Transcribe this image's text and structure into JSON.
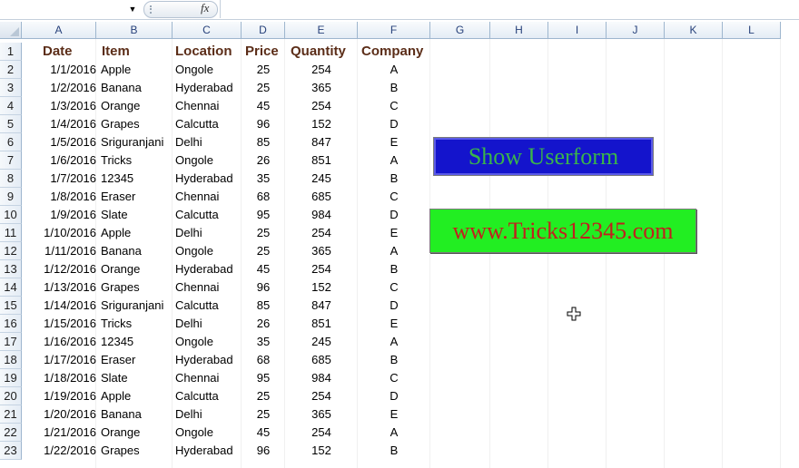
{
  "formula_bar": {
    "fx_label": "fx",
    "name_box_value": "",
    "formula_value": ""
  },
  "columns": [
    "A",
    "B",
    "C",
    "D",
    "E",
    "F",
    "G",
    "H",
    "I",
    "J",
    "K",
    "L"
  ],
  "rows": [
    "1",
    "2",
    "3",
    "4",
    "5",
    "6",
    "7",
    "8",
    "9",
    "10",
    "11",
    "12",
    "13",
    "14",
    "15",
    "16",
    "17",
    "18",
    "19",
    "20",
    "21",
    "22",
    "23"
  ],
  "table": {
    "headers": [
      "Date",
      "Item",
      "Location",
      "Price",
      "Quantity",
      "Company"
    ],
    "data": [
      [
        "1/1/2016",
        "Apple",
        "Ongole",
        "25",
        "254",
        "A"
      ],
      [
        "1/2/2016",
        "Banana",
        "Hyderabad",
        "25",
        "365",
        "B"
      ],
      [
        "1/3/2016",
        "Orange",
        "Chennai",
        "45",
        "254",
        "C"
      ],
      [
        "1/4/2016",
        "Grapes",
        "Calcutta",
        "96",
        "152",
        "D"
      ],
      [
        "1/5/2016",
        "Sriguranjani",
        "Delhi",
        "85",
        "847",
        "E"
      ],
      [
        "1/6/2016",
        "Tricks",
        "Ongole",
        "26",
        "851",
        "A"
      ],
      [
        "1/7/2016",
        "12345",
        "Hyderabad",
        "35",
        "245",
        "B"
      ],
      [
        "1/8/2016",
        "Eraser",
        "Chennai",
        "68",
        "685",
        "C"
      ],
      [
        "1/9/2016",
        "Slate",
        "Calcutta",
        "95",
        "984",
        "D"
      ],
      [
        "1/10/2016",
        "Apple",
        "Delhi",
        "25",
        "254",
        "E"
      ],
      [
        "1/11/2016",
        "Banana",
        "Ongole",
        "25",
        "365",
        "A"
      ],
      [
        "1/12/2016",
        "Orange",
        "Hyderabad",
        "45",
        "254",
        "B"
      ],
      [
        "1/13/2016",
        "Grapes",
        "Chennai",
        "96",
        "152",
        "C"
      ],
      [
        "1/14/2016",
        "Sriguranjani",
        "Calcutta",
        "85",
        "847",
        "D"
      ],
      [
        "1/15/2016",
        "Tricks",
        "Delhi",
        "26",
        "851",
        "E"
      ],
      [
        "1/16/2016",
        "12345",
        "Ongole",
        "35",
        "245",
        "A"
      ],
      [
        "1/17/2016",
        "Eraser",
        "Hyderabad",
        "68",
        "685",
        "B"
      ],
      [
        "1/18/2016",
        "Slate",
        "Chennai",
        "95",
        "984",
        "C"
      ],
      [
        "1/19/2016",
        "Apple",
        "Calcutta",
        "25",
        "254",
        "D"
      ],
      [
        "1/20/2016",
        "Banana",
        "Delhi",
        "25",
        "365",
        "E"
      ],
      [
        "1/21/2016",
        "Orange",
        "Ongole",
        "45",
        "254",
        "A"
      ],
      [
        "1/22/2016",
        "Grapes",
        "Hyderabad",
        "96",
        "152",
        "B"
      ]
    ]
  },
  "buttons": {
    "show_userform": "Show Userform",
    "website": "www.Tricks12345.com"
  },
  "colors": {
    "header_text": "#5b2d18",
    "userform_bg": "#1414cc",
    "userform_text": "#3ab54a",
    "website_bg": "#22ee22",
    "website_text": "#c0201e"
  },
  "icons": {
    "cursor": "move-cursor-icon",
    "fx": "fx-icon",
    "dropdown": "chevron-down-icon"
  }
}
